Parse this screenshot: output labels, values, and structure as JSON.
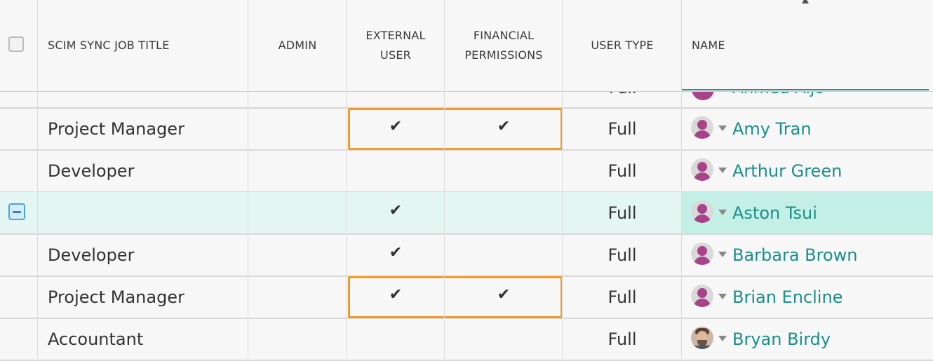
{
  "header": {
    "job_title": "SCIM SYNC JOB TITLE",
    "admin": "ADMIN",
    "external_user": [
      "EXTERNAL",
      "USER"
    ],
    "financial_permissions": [
      "FINANCIAL",
      "PERMISSIONS"
    ],
    "user_type": "USER TYPE",
    "name": "NAME"
  },
  "partial_row": {
    "user_type": "Full",
    "name": "Ahmed Aljo"
  },
  "check_glyph": "✔",
  "rows": [
    {
      "job_title": "Project Manager",
      "external": true,
      "financial": true,
      "user_type": "Full",
      "name": "Amy Tran",
      "avatar": "placeholder-avatar-icon",
      "selected": false,
      "highlighted": true
    },
    {
      "job_title": "Developer",
      "external": false,
      "financial": false,
      "user_type": "Full",
      "name": "Arthur Green",
      "avatar": "placeholder-avatar-icon",
      "selected": false,
      "highlighted": false
    },
    {
      "job_title": "",
      "external": true,
      "financial": false,
      "user_type": "Full",
      "name": "Aston Tsui",
      "avatar": "placeholder-avatar-icon",
      "selected": true,
      "highlighted": false
    },
    {
      "job_title": "Developer",
      "external": true,
      "financial": false,
      "user_type": "Full",
      "name": "Barbara Brown",
      "avatar": "placeholder-avatar-icon",
      "selected": false,
      "highlighted": false
    },
    {
      "job_title": "Project Manager",
      "external": true,
      "financial": true,
      "user_type": "Full",
      "name": "Brian Encline",
      "avatar": "placeholder-avatar-icon",
      "selected": false,
      "highlighted": true
    },
    {
      "job_title": "Accountant",
      "external": false,
      "financial": false,
      "user_type": "Full",
      "name": "Bryan Birdy",
      "avatar": "photo-avatar",
      "selected": false,
      "highlighted": false
    }
  ],
  "colors": {
    "accent": "#1b8f88",
    "highlight_border": "#f39a2a",
    "selected_row": "#e3f6f2",
    "avatar_placeholder": "#a8438a"
  }
}
